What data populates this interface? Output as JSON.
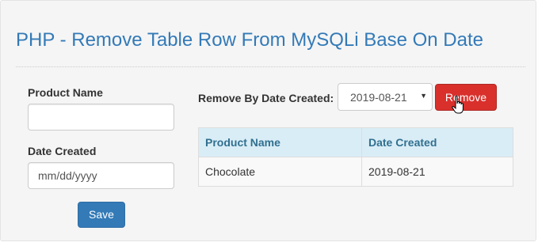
{
  "page": {
    "title": "PHP - Remove Table Row From MySQLi Base On Date"
  },
  "form": {
    "product_name_label": "Product Name",
    "product_name_value": "",
    "date_created_label": "Date Created",
    "date_created_placeholder": "mm/dd/yyyy",
    "save_label": "Save"
  },
  "filter": {
    "label": "Remove By Date Created:",
    "selected_date": "2019-08-21",
    "remove_label": "Remove"
  },
  "table": {
    "columns": [
      "Product Name",
      "Date Created"
    ],
    "rows": [
      [
        "Chocolate",
        "2019-08-21"
      ]
    ]
  },
  "colors": {
    "title": "#337ab7",
    "primary": "#337ab7",
    "danger": "#d9302c",
    "table_header_bg": "#d9edf7"
  },
  "icons": {
    "select_caret": "caret-down-icon",
    "cursor": "hand-pointer-icon"
  }
}
